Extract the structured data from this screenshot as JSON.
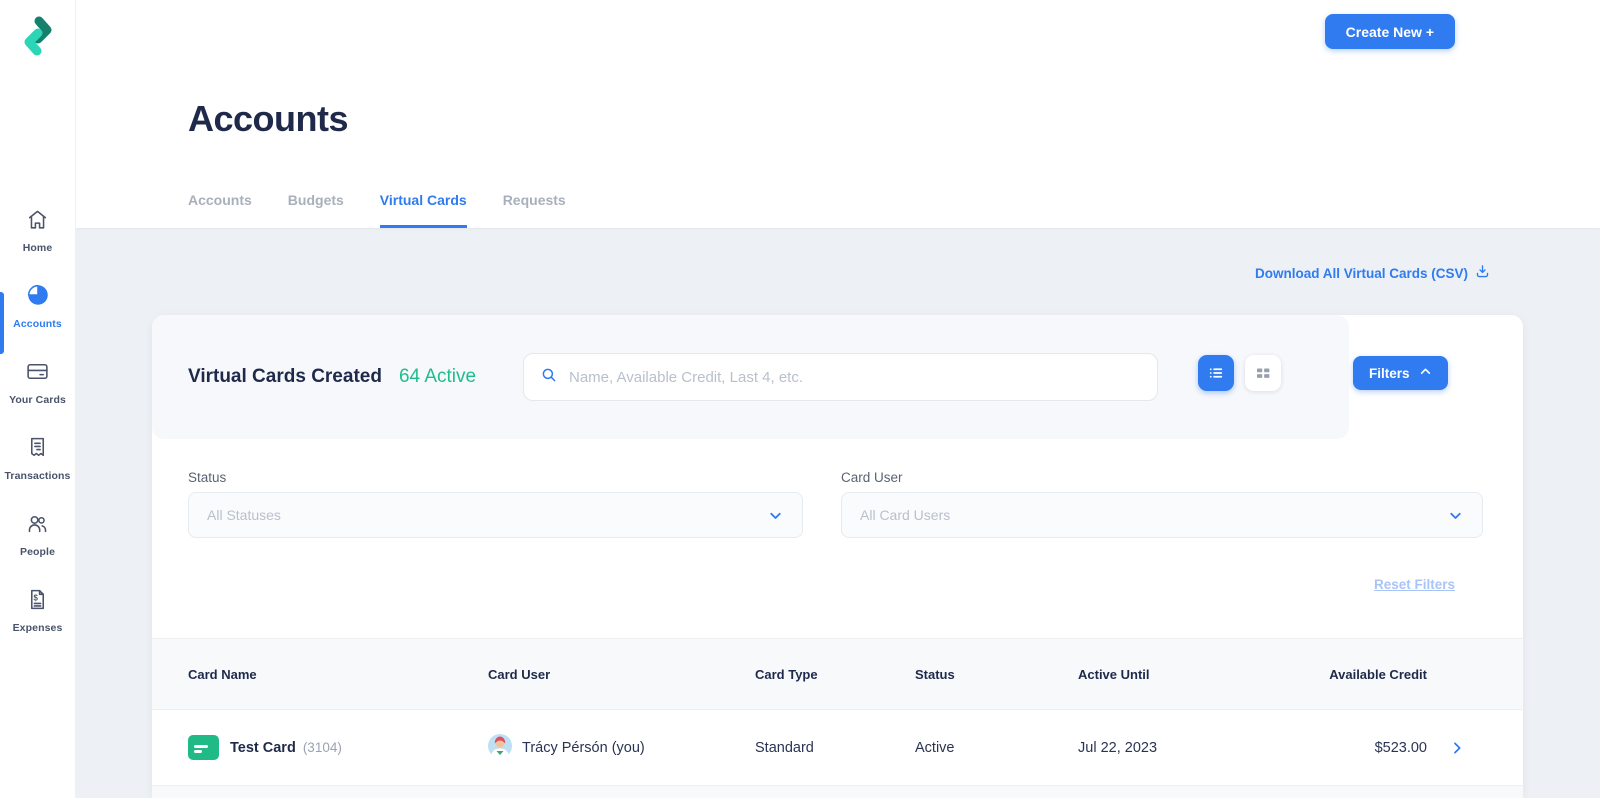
{
  "colors": {
    "accent_blue": "#2F7BEF",
    "success_green": "#1EBD8D",
    "navy": "#1F2A4B",
    "brand_teal_dark": "#15806C",
    "brand_teal_light": "#2BD5B5",
    "page_background": "#EDF0F5"
  },
  "sidebar": {
    "items": [
      {
        "label": "Home",
        "icon": "home-icon",
        "active": false
      },
      {
        "label": "Accounts",
        "icon": "pie-chart-icon",
        "active": true
      },
      {
        "label": "Your Cards",
        "icon": "credit-card-icon",
        "active": false
      },
      {
        "label": "Transactions",
        "icon": "receipt-icon",
        "active": false
      },
      {
        "label": "People",
        "icon": "people-icon",
        "active": false
      },
      {
        "label": "Expenses",
        "icon": "expense-doc-icon",
        "active": false
      }
    ]
  },
  "header": {
    "title": "Accounts",
    "create_button": "Create New +",
    "tabs": [
      {
        "label": "Accounts",
        "active": false
      },
      {
        "label": "Budgets",
        "active": false
      },
      {
        "label": "Virtual Cards",
        "active": true
      },
      {
        "label": "Requests",
        "active": false
      }
    ]
  },
  "content": {
    "download_link": "Download All Virtual Cards (CSV)",
    "panel": {
      "title": "Virtual Cards Created",
      "active_count": "64 Active",
      "search_placeholder": "Name, Available Credit, Last 4, etc.",
      "filters_button": "Filters",
      "filters": {
        "status_label": "Status",
        "status_value": "All Statuses",
        "card_user_label": "Card User",
        "card_user_value": "All Card Users",
        "reset_label": "Reset Filters"
      },
      "table": {
        "columns": [
          "Card Name",
          "Card User",
          "Card Type",
          "Status",
          "Active Until",
          "Available Credit"
        ],
        "rows": [
          {
            "card_name": "Test Card",
            "card_last4": "(3104)",
            "card_user": "Trácy Pérsón (you)",
            "card_type": "Standard",
            "status": "Active",
            "active_until": "Jul 22, 2023",
            "available_credit": "$523.00"
          }
        ]
      }
    }
  }
}
